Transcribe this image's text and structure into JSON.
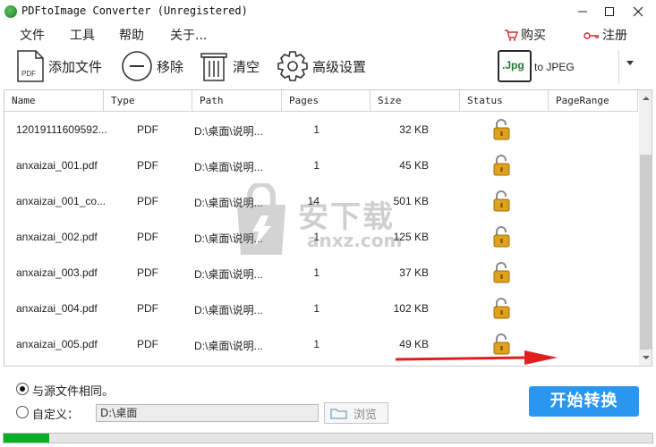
{
  "window": {
    "title": "PDFtoImage Converter (Unregistered)",
    "minimize_icon": "minimize-icon",
    "maximize_icon": "maximize-icon",
    "close_icon": "close-icon"
  },
  "menu": {
    "items": [
      "文件",
      "工具",
      "帮助",
      "关于..."
    ],
    "buy": "购买",
    "register": "注册"
  },
  "toolbar": {
    "add_files": "添加文件",
    "remove": "移除",
    "clear": "清空",
    "advanced": "高级设置",
    "format_badge": ".Jpg",
    "format_label": "to JPEG"
  },
  "table": {
    "columns": [
      "Name",
      "Type",
      "Path",
      "Pages",
      "Size",
      "Status",
      "PageRange"
    ],
    "rows": [
      {
        "name": "12019111609592...",
        "type": "PDF",
        "path": "D:\\桌面\\说明...",
        "pages": "1",
        "size": "32 KB"
      },
      {
        "name": "anxaizai_001.pdf",
        "type": "PDF",
        "path": "D:\\桌面\\说明...",
        "pages": "1",
        "size": "45 KB"
      },
      {
        "name": "anxaizai_001_co...",
        "type": "PDF",
        "path": "D:\\桌面\\说明...",
        "pages": "14",
        "size": "501 KB"
      },
      {
        "name": "anxaizai_002.pdf",
        "type": "PDF",
        "path": "D:\\桌面\\说明...",
        "pages": "1",
        "size": "125 KB"
      },
      {
        "name": "anxaizai_003.pdf",
        "type": "PDF",
        "path": "D:\\桌面\\说明...",
        "pages": "1",
        "size": "37 KB"
      },
      {
        "name": "anxaizai_004.pdf",
        "type": "PDF",
        "path": "D:\\桌面\\说明...",
        "pages": "1",
        "size": "102 KB"
      },
      {
        "name": "anxaizai_005.pdf",
        "type": "PDF",
        "path": "D:\\桌面\\说明...",
        "pages": "1",
        "size": "49 KB"
      }
    ]
  },
  "watermark": {
    "text": "安下载",
    "sub": "anxz.com"
  },
  "output": {
    "same_as_source": "与源文件相同。",
    "custom": "自定义：",
    "path_value": "D:\\桌面",
    "browse": "浏览",
    "start": "开始转换"
  },
  "progress": {
    "fraction": 0.07
  },
  "colors": {
    "accent": "#2a96f0",
    "progress": "#06b025",
    "lock": "#e0a21a",
    "arrow": "#e02020"
  }
}
